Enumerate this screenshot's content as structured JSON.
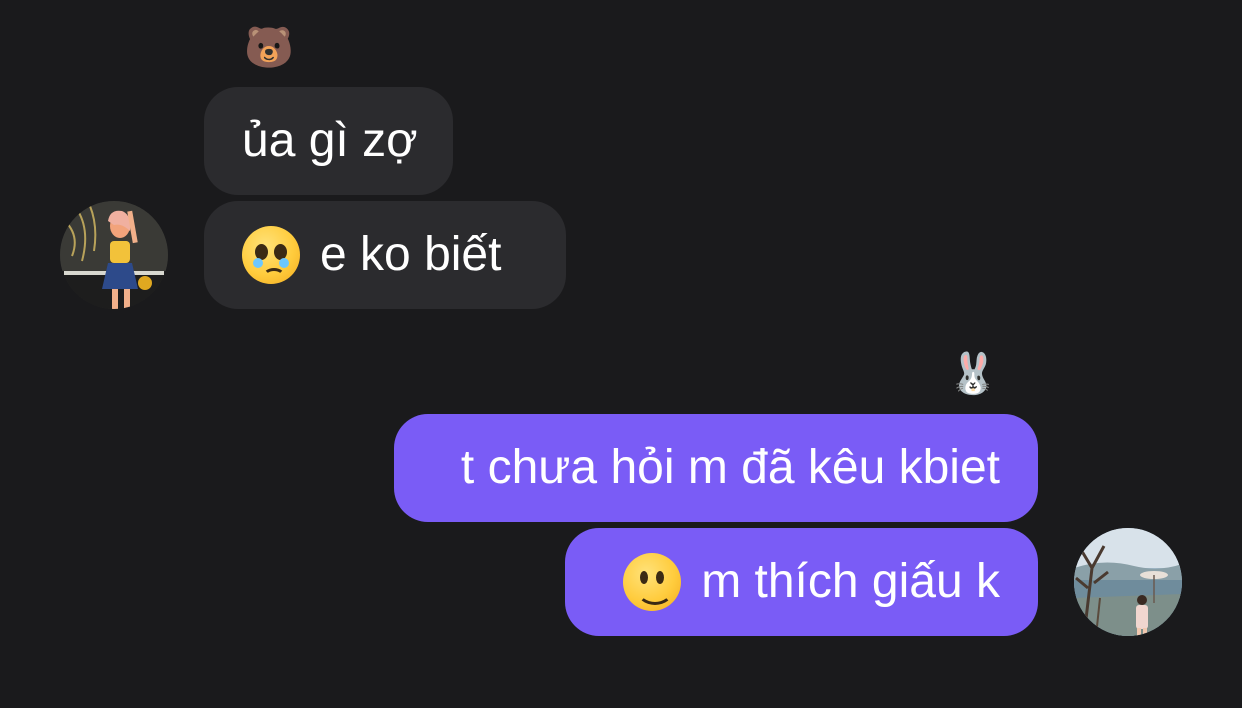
{
  "conversation": {
    "incoming": {
      "reaction_icon": "bear-face-icon",
      "messages": [
        {
          "text": "ủa gì zợ"
        },
        {
          "emoji_icon": "pleading-face-icon",
          "text": "e ko biết"
        }
      ],
      "avatar_icon": "contact-photo-avatar"
    },
    "outgoing": {
      "reaction_icon": "rabbit-face-icon",
      "messages": [
        {
          "text": "t chưa hỏi m đã kêu kbiet"
        },
        {
          "emoji_icon": "slightly-smiling-face-icon",
          "text": "m thích giấu k"
        }
      ],
      "avatar_icon": "user-photo-avatar"
    }
  },
  "colors": {
    "background": "#1a1a1c",
    "incoming_bubble": "#2b2b2e",
    "outgoing_bubble": "#7a5cf6",
    "text": "#ffffff"
  }
}
